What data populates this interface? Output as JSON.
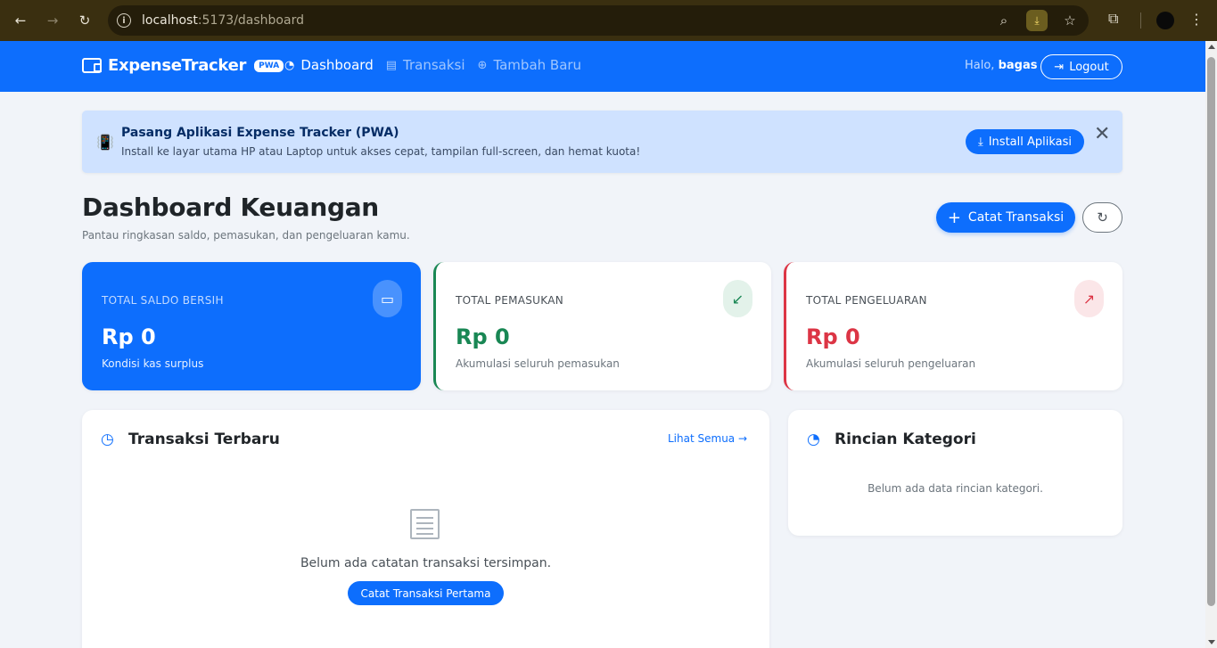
{
  "browser": {
    "url_host": "localhost",
    "url_path": ":5173/dashboard"
  },
  "navbar": {
    "brand": "ExpenseTracker",
    "badge": "PWA",
    "links": [
      {
        "label": "Dashboard",
        "active": true
      },
      {
        "label": "Transaksi",
        "active": false
      },
      {
        "label": "Tambah Baru",
        "active": false
      }
    ],
    "greeting_prefix": "Halo,",
    "username": "bagas",
    "logout_label": "Logout"
  },
  "pwa_banner": {
    "title": "Pasang Aplikasi Expense Tracker (PWA)",
    "description": "Install ke layar utama HP atau Laptop untuk akses cepat, tampilan full-screen, dan hemat kuota!",
    "install_label": "Install Aplikasi",
    "close_symbol": "✕"
  },
  "header": {
    "title": "Dashboard Keuangan",
    "subtitle": "Pantau ringkasan saldo, pemasukan, dan pengeluaran kamu.",
    "catat_label": "Catat Transaksi"
  },
  "cards": {
    "saldo": {
      "label": "TOTAL SALDO BERSIH",
      "amount": "Rp 0",
      "note": "Kondisi kas surplus",
      "icon": "wallet-icon"
    },
    "masuk": {
      "label": "TOTAL PEMASUKAN",
      "amount": "Rp 0",
      "note": "Akumulasi seluruh pemasukan",
      "icon": "arrow-down-left-icon"
    },
    "keluar": {
      "label": "TOTAL PENGELUARAN",
      "amount": "Rp 0",
      "note": "Akumulasi seluruh pengeluaran",
      "icon": "arrow-up-right-icon"
    }
  },
  "recent": {
    "title": "Transaksi Terbaru",
    "see_all": "Lihat Semua →",
    "empty_text": "Belum ada catatan transaksi tersimpan.",
    "first_button": "Catat Transaksi Pertama"
  },
  "kategori": {
    "title": "Rincian Kategori",
    "empty_text": "Belum ada data rincian kategori."
  },
  "colors": {
    "primary": "#0d6efd",
    "success": "#198754",
    "danger": "#dc3545",
    "banner_bg": "#cfe2ff"
  }
}
